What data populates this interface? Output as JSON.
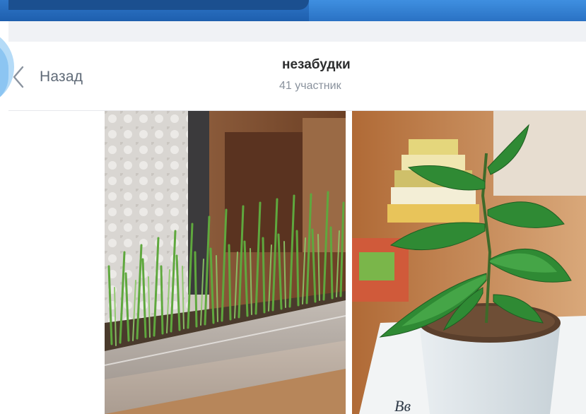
{
  "header": {
    "back_label": "Назад",
    "title": "незабудки",
    "subtitle": "41 участник"
  },
  "icons": {
    "back": "chevron-left-icon"
  },
  "colors": {
    "back_label": "#5f6a77",
    "title": "#2c2d2e",
    "subtitle": "#8a929d",
    "top_band": "#1e5fae"
  },
  "photos": [
    {
      "name": "photo-grass-seedlings"
    },
    {
      "name": "photo-potted-tree-seedling"
    }
  ]
}
